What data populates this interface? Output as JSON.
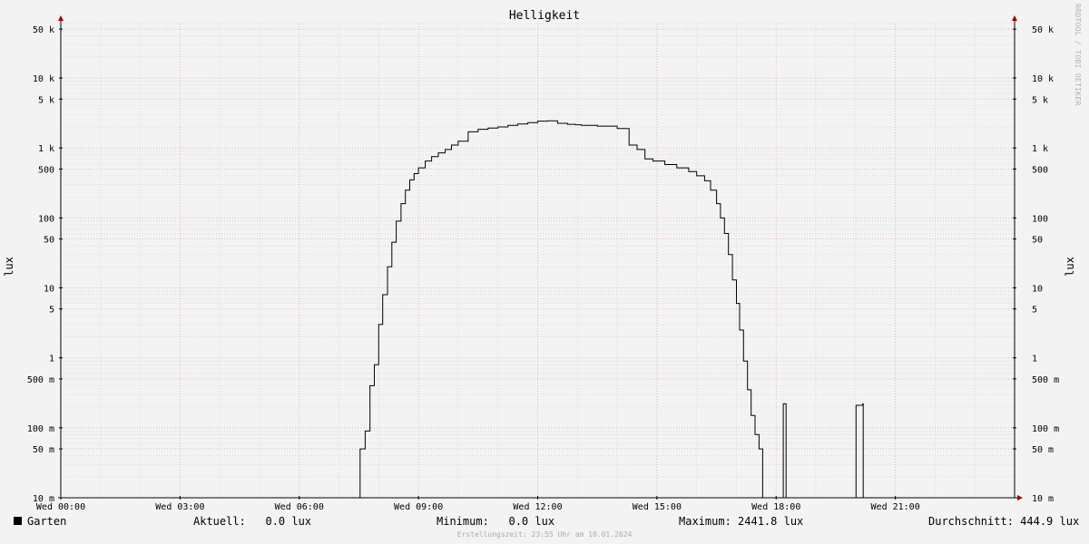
{
  "chart_data": {
    "type": "line",
    "title": "Helligkeit",
    "ylabel": "lux",
    "y_scale": "log",
    "ylim": [
      0.01,
      60000
    ],
    "xlim": [
      0,
      24
    ],
    "x_ticks": [
      {
        "hour": 0,
        "label": "Wed 00:00"
      },
      {
        "hour": 3,
        "label": "Wed 03:00"
      },
      {
        "hour": 6,
        "label": "Wed 06:00"
      },
      {
        "hour": 9,
        "label": "Wed 09:00"
      },
      {
        "hour": 12,
        "label": "Wed 12:00"
      },
      {
        "hour": 15,
        "label": "Wed 15:00"
      },
      {
        "hour": 18,
        "label": "Wed 18:00"
      },
      {
        "hour": 21,
        "label": "Wed 21:00"
      }
    ],
    "y_ticks": [
      {
        "value": 50000,
        "label": "50 k"
      },
      {
        "value": 10000,
        "label": "10 k"
      },
      {
        "value": 5000,
        "label": "5 k"
      },
      {
        "value": 1000,
        "label": "1 k"
      },
      {
        "value": 500,
        "label": "500"
      },
      {
        "value": 100,
        "label": "100"
      },
      {
        "value": 50,
        "label": "50"
      },
      {
        "value": 10,
        "label": "10"
      },
      {
        "value": 5,
        "label": "5"
      },
      {
        "value": 1,
        "label": "1"
      },
      {
        "value": 0.5,
        "label": "500 m"
      },
      {
        "value": 0.1,
        "label": "100 m"
      },
      {
        "value": 0.05,
        "label": "50 m"
      },
      {
        "value": 0.01,
        "label": "10 m"
      }
    ],
    "grid": true,
    "colors": {
      "line": "#000000",
      "major_grid": "#e9a6b0",
      "minor_grid": "#cccccc",
      "axis": "#000000",
      "arrow": "#a00000"
    },
    "series": [
      {
        "name": "Garten",
        "x": [
          0,
          7.53,
          7.66,
          7.78,
          7.89,
          8.0,
          8.1,
          8.22,
          8.33,
          8.44,
          8.56,
          8.67,
          8.78,
          8.89,
          9.0,
          9.17,
          9.33,
          9.5,
          9.67,
          9.83,
          10.0,
          10.25,
          10.5,
          10.75,
          11.0,
          11.25,
          11.5,
          11.75,
          12.0,
          12.25,
          12.5,
          12.75,
          12.95,
          13.1,
          13.5,
          14.0,
          14.3,
          14.5,
          14.7,
          14.9,
          15.2,
          15.5,
          15.8,
          16.0,
          16.2,
          16.35,
          16.5,
          16.6,
          16.7,
          16.8,
          16.9,
          17.0,
          17.08,
          17.18,
          17.28,
          17.37,
          17.47,
          17.57,
          17.66,
          17.75,
          17.8,
          18.17,
          18.18,
          18.24,
          18.25,
          20.0,
          20.01,
          20.18,
          20.19,
          24
        ],
        "values": [
          0.01,
          0.05,
          0.09,
          0.4,
          0.8,
          3.0,
          8.0,
          20,
          45,
          90,
          160,
          250,
          350,
          430,
          520,
          650,
          750,
          850,
          950,
          1100,
          1250,
          1700,
          1850,
          1920,
          2000,
          2100,
          2200,
          2300,
          2420,
          2441.8,
          2250,
          2180,
          2150,
          2100,
          2050,
          1900,
          1100,
          950,
          700,
          650,
          580,
          520,
          460,
          400,
          340,
          250,
          160,
          100,
          60,
          30,
          13,
          6,
          2.5,
          0.9,
          0.35,
          0.15,
          0.08,
          0.05,
          0.01,
          0.01,
          0.01,
          0.01,
          0.22,
          0.22,
          0.01,
          0.01,
          0.21,
          0.22,
          0.01,
          0.01
        ]
      }
    ],
    "legend": {
      "series": "Garten",
      "current": "Aktuell:   0.0 lux",
      "minimum": "Minimum:   0.0 lux",
      "maximum": "Maximum: 2441.8 lux",
      "average": "Durchschnitt: 444.9 lux"
    }
  },
  "watermark": "RRDTOOL / TOBI OETIKER",
  "footer": "Erstellungszeit: 23:55 Uhr am 10.01.2024"
}
